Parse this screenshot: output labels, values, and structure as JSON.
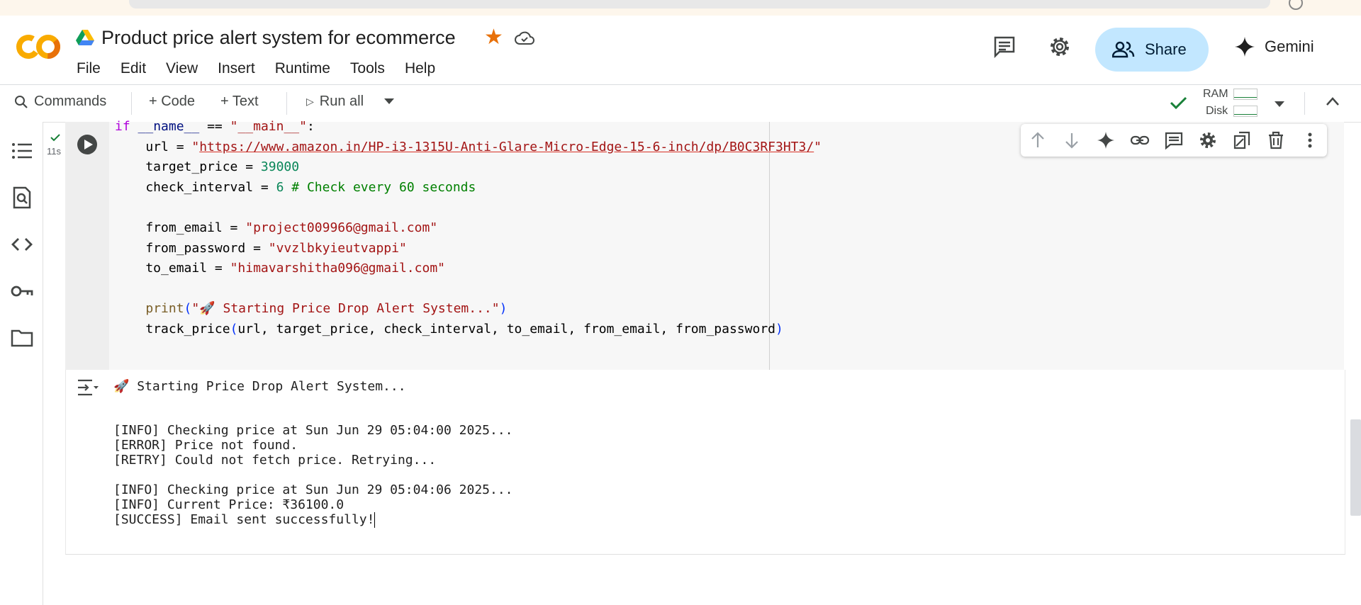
{
  "header": {
    "logo_text": "CO",
    "title": "Product price alert system for ecommerce",
    "menu": [
      "File",
      "Edit",
      "View",
      "Insert",
      "Runtime",
      "Tools",
      "Help"
    ],
    "share_label": "Share",
    "gemini_label": "Gemini"
  },
  "toolbar": {
    "commands_label": "Commands",
    "code_label": "+ Code",
    "text_label": "+ Text",
    "run_all_label": "Run all",
    "ram_label": "RAM",
    "disk_label": "Disk"
  },
  "cell": {
    "exec_time": "11s",
    "lines": [
      [
        {
          "t": "if",
          "c": "kw"
        },
        {
          "t": " "
        },
        {
          "t": "__name__",
          "c": "var"
        },
        {
          "t": " == "
        },
        {
          "t": "\"__main__\"",
          "c": "str"
        },
        {
          "t": ":"
        }
      ],
      [
        {
          "t": "    url = "
        },
        {
          "t": "\"",
          "c": "str"
        },
        {
          "t": "https://www.amazon.in/HP-i3-1315U-Anti-Glare-Micro-Edge-15-6-inch/dp/B0C3RF3HT3/",
          "c": "url"
        },
        {
          "t": "\"",
          "c": "str"
        }
      ],
      [
        {
          "t": "    target_price = "
        },
        {
          "t": "39000",
          "c": "num"
        }
      ],
      [
        {
          "t": "    check_interval = "
        },
        {
          "t": "6",
          "c": "num"
        },
        {
          "t": " "
        },
        {
          "t": "# Check every 60 seconds",
          "c": "cmt"
        }
      ],
      [
        {
          "t": ""
        }
      ],
      [
        {
          "t": "    from_email = "
        },
        {
          "t": "\"project009966@gmail.com\"",
          "c": "str"
        }
      ],
      [
        {
          "t": "    from_password = "
        },
        {
          "t": "\"vvzlbkyieutvappi\"",
          "c": "str"
        }
      ],
      [
        {
          "t": "    to_email = "
        },
        {
          "t": "\"himavarshitha096@gmail.com\"",
          "c": "str"
        }
      ],
      [
        {
          "t": ""
        }
      ],
      [
        {
          "t": "    "
        },
        {
          "t": "print",
          "c": "fn"
        },
        {
          "t": "(",
          "c": "par"
        },
        {
          "t": "\"🚀 Starting Price Drop Alert System...\"",
          "c": "str"
        },
        {
          "t": ")",
          "c": "par"
        }
      ],
      [
        {
          "t": "    track_price"
        },
        {
          "t": "(",
          "c": "par"
        },
        {
          "t": "url, target_price, check_interval, to_email, from_email, from_password"
        },
        {
          "t": ")",
          "c": "par"
        }
      ]
    ]
  },
  "output": {
    "lines": [
      "🚀 Starting Price Drop Alert System...",
      "",
      "[INFO] Checking price at Sun Jun 29 05:04:00 2025...",
      "[ERROR] Price not found.",
      "[RETRY] Could not fetch price. Retrying...",
      "",
      "[INFO] Checking price at Sun Jun 29 05:04:06 2025...",
      "[INFO] Current Price: ₹36100.0",
      "[SUCCESS] Email sent successfully!"
    ]
  },
  "colors": {
    "share_bg": "#c2e7ff",
    "star": "#e8710a",
    "check": "#188038",
    "logo": "#f9ab00"
  }
}
